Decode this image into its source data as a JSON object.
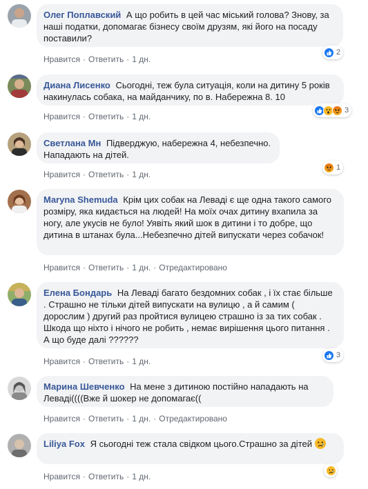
{
  "labels": {
    "like": "Нравится",
    "reply": "Ответить",
    "time": "1 дн.",
    "edited": "Отредактировано",
    "dot": "·"
  },
  "comments": [
    {
      "author": "Олег Поплавский",
      "text": "А що робить в цей час міський голова? Знову, за наші податки, допомагає бізнесу своїм друзям, які його на посаду поставили?",
      "reactions": [
        "like"
      ],
      "count": "2",
      "edited": false
    },
    {
      "author": "Диана Лисенко",
      "text": "Сьогодні, теж була ситуація, коли на дитину 5 років накинулась собака, на майданчику, по в. Набережна 8. 10",
      "reactions": [
        "like",
        "wow",
        "angry"
      ],
      "count": "3",
      "edited": false
    },
    {
      "author": "Светлана Мн",
      "text": "Підверджую, набережна 4, небезпечно. Нападають на дітей.",
      "reactions": [
        "angry"
      ],
      "count": "1",
      "edited": false
    },
    {
      "author": "Maryna Shemuda",
      "text": "Крім цих собак на Леваді є ще одна такого самого розміру, яка кидається на людей! На моїх очах дитину вхапила за ногу, але укусів не було! Уявіть який шок в дитини і то добре, що дитина в штанах була...Небезпечно дітей випускати через собачок!",
      "reactions": [],
      "count": "",
      "edited": true
    },
    {
      "author": "Елена Бондарь",
      "text": "На Леваді багато бездомних собак , і їх стає більше . Страшно не тільки дітей випускати на вулицю , а й самим ( дорослим ) другий раз пройтися вулицею страшно із за тих собак . Шкода що ніхто і нічого не робить , немає вирішення цього питання . А що буде далі ??????",
      "reactions": [
        "like"
      ],
      "count": "3",
      "edited": false
    },
    {
      "author": "Марина Шевченко",
      "text": "На мене з дитиною постійно нападають на Леваді((((Вже й шокер не допомагає((",
      "reactions": [],
      "count": "",
      "edited": true
    },
    {
      "author": "Liliya Fox",
      "text": "Я сьогодні теж стала свідком цього.Страшно за дітей",
      "reactions": [
        "sad"
      ],
      "count": "",
      "edited": false
    }
  ],
  "colors": {
    "author": "#385898",
    "bubble": "#f2f3f5",
    "meta": "#606770",
    "like": "#1877f2"
  }
}
